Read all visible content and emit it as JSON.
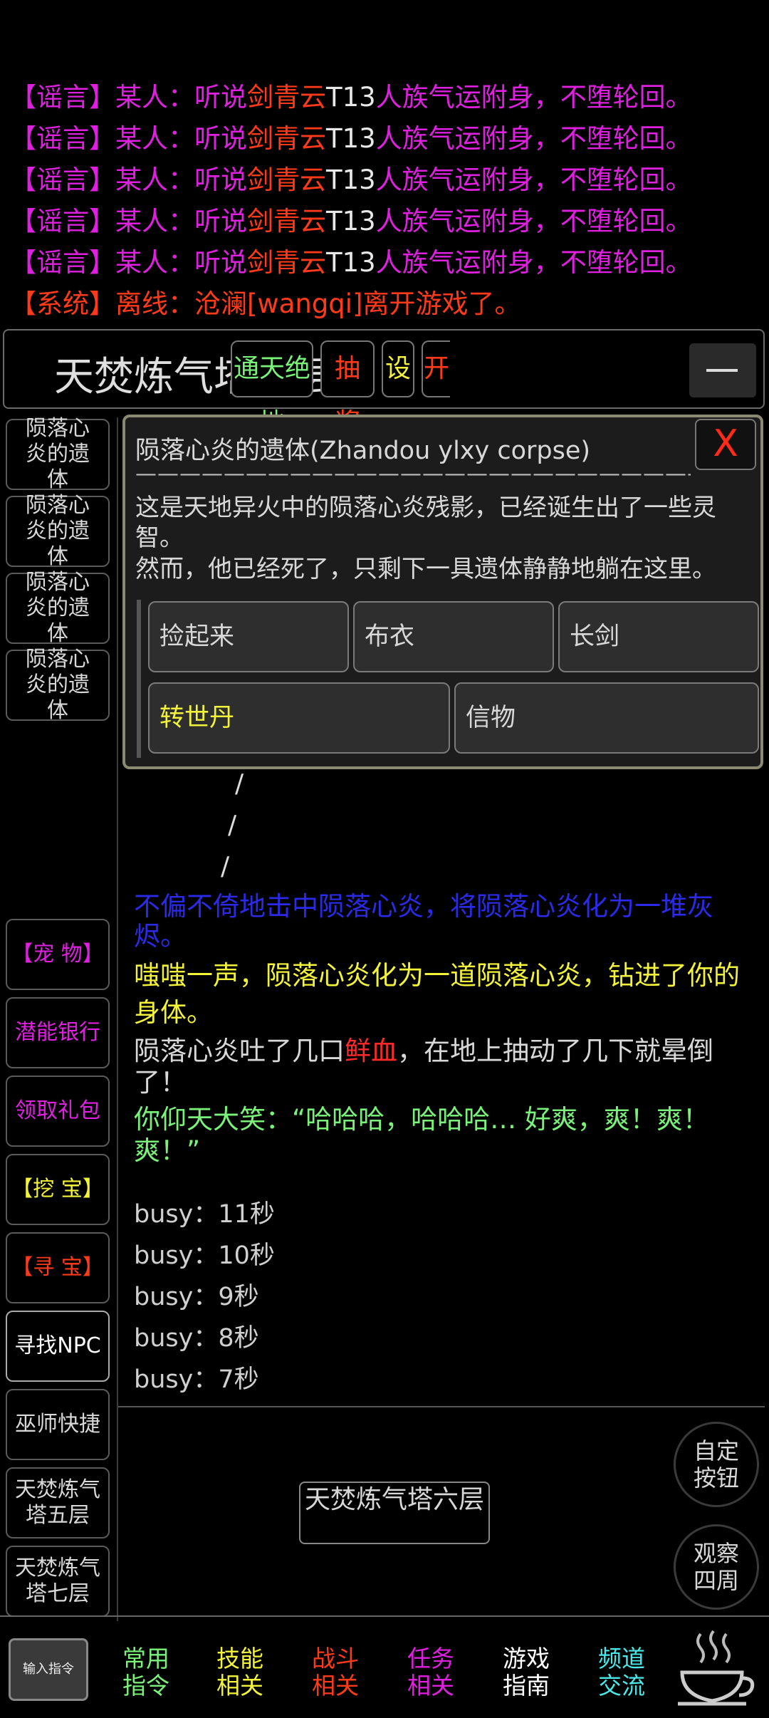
{
  "chat": {
    "rumors": [
      {
        "channel": "【谣言】",
        "speaker": "某人：",
        "pre": "听说",
        "name": "剑青云",
        "code": "T13",
        "msg": "人族气运附身，",
        "tail": "不堕轮回。"
      },
      {
        "channel": "【谣言】",
        "speaker": "某人：",
        "pre": "听说",
        "name": "剑青云",
        "code": "T13",
        "msg": "人族气运附身，",
        "tail": "不堕轮回。"
      },
      {
        "channel": "【谣言】",
        "speaker": "某人：",
        "pre": "听说",
        "name": "剑青云",
        "code": "T13",
        "msg": "人族气运附身，",
        "tail": "不堕轮回。"
      },
      {
        "channel": "【谣言】",
        "speaker": "某人：",
        "pre": "听说",
        "name": "剑青云",
        "code": "T13",
        "msg": "人族气运附身，",
        "tail": "不堕轮回。"
      },
      {
        "channel": "【谣言】",
        "speaker": "某人：",
        "pre": "听说",
        "name": "剑青云",
        "code": "T13",
        "msg": "人族气运附身，",
        "tail": "不堕轮回。"
      }
    ],
    "system": {
      "channel": "【系统】",
      "speaker": "离线：",
      "msg": "沧澜[wangqi]离开游戏了。"
    }
  },
  "header": {
    "room_title": "天焚炼气塔六层",
    "btn_tongtian": "通天绝地",
    "btn_lottery": "抽 奖",
    "btn_settings": "设",
    "btn_open": "开",
    "btn_collapse": "—"
  },
  "left_column": {
    "corpses": [
      "陨落心炎的遗体",
      "陨落心炎的遗体",
      "陨落心炎的遗体",
      "陨落心炎的遗体"
    ],
    "pet": "【宠 物】",
    "bank": "潜能银行",
    "gift": "领取礼包",
    "dig": "【挖 宝】",
    "seek": "【寻 宝】",
    "find_npc": "寻找NPC",
    "wizard": "巫师快捷",
    "floor5": "天焚炼气塔五层",
    "floor7": "天焚炼气塔七层"
  },
  "popup": {
    "title": "陨落心炎的遗体(Zhandou ylxy corpse)",
    "close": "X",
    "separator": "——————————————————————————",
    "desc1": "这是天地异火中的陨落心炎残影，已经诞生出了一些灵智。",
    "desc2": "然而，他已经死了，只剩下一具遗体静静地躺在这里。",
    "actions": {
      "pickup": "捡起来",
      "cloth": "布衣",
      "sword": "长剑",
      "pill": "转世丹",
      "token": "信物"
    }
  },
  "log": {
    "slashes": [
      "/",
      "/",
      "/"
    ],
    "hit": "不偏不倚地击中陨落心炎，将陨落心炎化为一堆灰烬。",
    "absorb": "嗤嗤一声，陨落心炎化为一道陨落心炎，钻进了你的身体。",
    "vomit_pre": "陨落心炎吐了几口",
    "vomit_blood": "鲜血",
    "vomit_post": "，在地上抽动了几下就晕倒了！",
    "laugh": "你仰天大笑：“哈哈哈，哈哈哈… 好爽，爽！爽！爽！”",
    "busy": [
      "busy：11秒",
      "busy：10秒",
      "busy：9秒",
      "busy：8秒",
      "busy：7秒"
    ]
  },
  "bottom_area": {
    "room_button": "天焚炼气塔六层",
    "custom_button": "自定按钮",
    "observe": "观察四周"
  },
  "nav": {
    "input_cmd": "输入指令",
    "common": "常用指令",
    "skills": "技能相关",
    "combat": "战斗相关",
    "quests": "任务相关",
    "guide": "游戏指南",
    "channels": "频道交流"
  },
  "colors": {
    "rumor": "#e020e0",
    "name": "#ff3a1a",
    "system": "#ff3a1a",
    "blue_text": "#2a2ae8",
    "yellow_text": "#f2f23a",
    "green_text": "#7af27a",
    "close": "#ff2a1a"
  }
}
